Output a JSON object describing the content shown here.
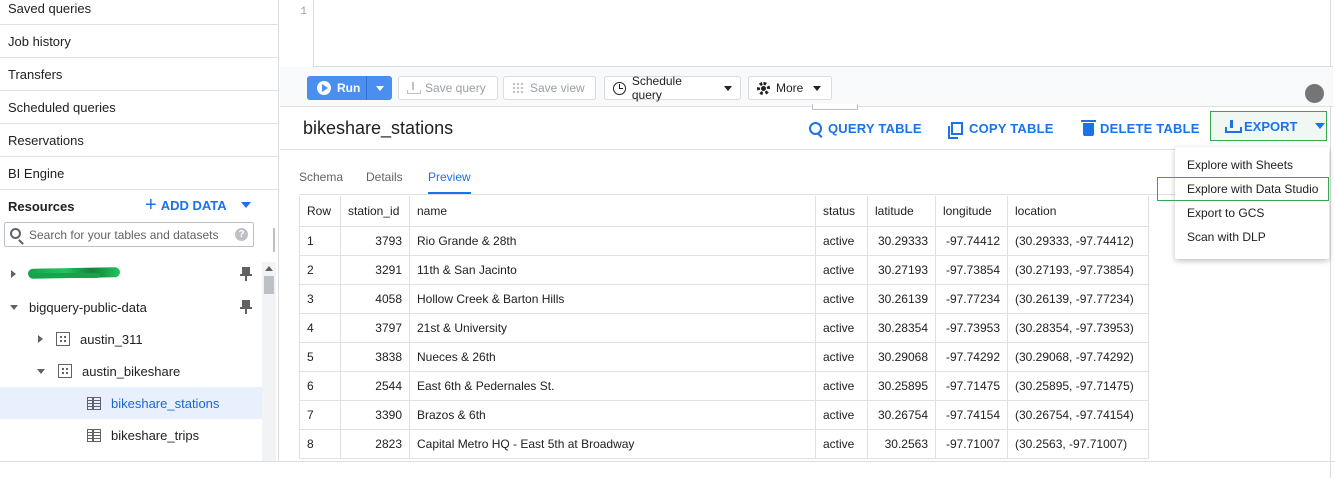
{
  "sidebar": {
    "nav_items": [
      "Saved queries",
      "Job history",
      "Transfers",
      "Scheduled queries",
      "Reservations",
      "BI Engine"
    ],
    "resources_label": "Resources",
    "add_data_label": "ADD DATA",
    "search_placeholder": "Search for your tables and datasets",
    "tree": [
      {
        "label": "",
        "level": 0,
        "expanded": false,
        "pinned": true
      },
      {
        "label": "bigquery-public-data",
        "level": 0,
        "expanded": true,
        "pinned": true
      },
      {
        "label": "austin_311",
        "level": 1,
        "expanded": false,
        "type": "dataset"
      },
      {
        "label": "austin_bikeshare",
        "level": 1,
        "expanded": true,
        "type": "dataset"
      },
      {
        "label": "bikeshare_stations",
        "level": 2,
        "type": "table",
        "selected": true
      },
      {
        "label": "bikeshare_trips",
        "level": 2,
        "type": "table"
      }
    ]
  },
  "editor": {
    "line_number": "1"
  },
  "toolbar": {
    "run_label": "Run",
    "save_query_label": "Save query",
    "save_view_label": "Save view",
    "schedule_query_label": "Schedule query",
    "more_label": "More"
  },
  "table_panel": {
    "title": "bikeshare_stations",
    "query_table_label": "QUERY TABLE",
    "copy_table_label": "COPY TABLE",
    "delete_table_label": "DELETE TABLE",
    "export_label": "EXPORT"
  },
  "export_menu": {
    "items": [
      "Explore with Sheets",
      "Explore with Data Studio",
      "Export to GCS",
      "Scan with DLP"
    ]
  },
  "tabs": [
    "Schema",
    "Details",
    "Preview"
  ],
  "active_tab": "Preview",
  "preview": {
    "columns": [
      "Row",
      "station_id",
      "name",
      "status",
      "latitude",
      "longitude",
      "location"
    ],
    "rows": [
      [
        "1",
        "3793",
        "Rio Grande & 28th",
        "active",
        "30.29333",
        "-97.74412",
        "(30.29333, -97.74412)"
      ],
      [
        "2",
        "3291",
        "11th & San Jacinto",
        "active",
        "30.27193",
        "-97.73854",
        "(30.27193, -97.73854)"
      ],
      [
        "3",
        "4058",
        "Hollow Creek & Barton Hills",
        "active",
        "30.26139",
        "-97.77234",
        "(30.26139, -97.77234)"
      ],
      [
        "4",
        "3797",
        "21st & University",
        "active",
        "30.28354",
        "-97.73953",
        "(30.28354, -97.73953)"
      ],
      [
        "5",
        "3838",
        "Nueces & 26th",
        "active",
        "30.29068",
        "-97.74292",
        "(30.29068, -97.74292)"
      ],
      [
        "6",
        "2544",
        "East 6th & Pedernales St.",
        "active",
        "30.25895",
        "-97.71475",
        "(30.25895, -97.71475)"
      ],
      [
        "7",
        "3390",
        "Brazos & 6th",
        "active",
        "30.26754",
        "-97.74154",
        "(30.26754, -97.74154)"
      ],
      [
        "8",
        "2823",
        "Capital Metro HQ - East 5th at Broadway",
        "active",
        "30.2563",
        "-97.71007",
        "(30.2563, -97.71007)"
      ]
    ]
  },
  "colors": {
    "accent": "#1a73e8",
    "run_button": "#4a8ef0",
    "highlight_border": "#34a853",
    "selected_row": "#e8f0fe"
  }
}
